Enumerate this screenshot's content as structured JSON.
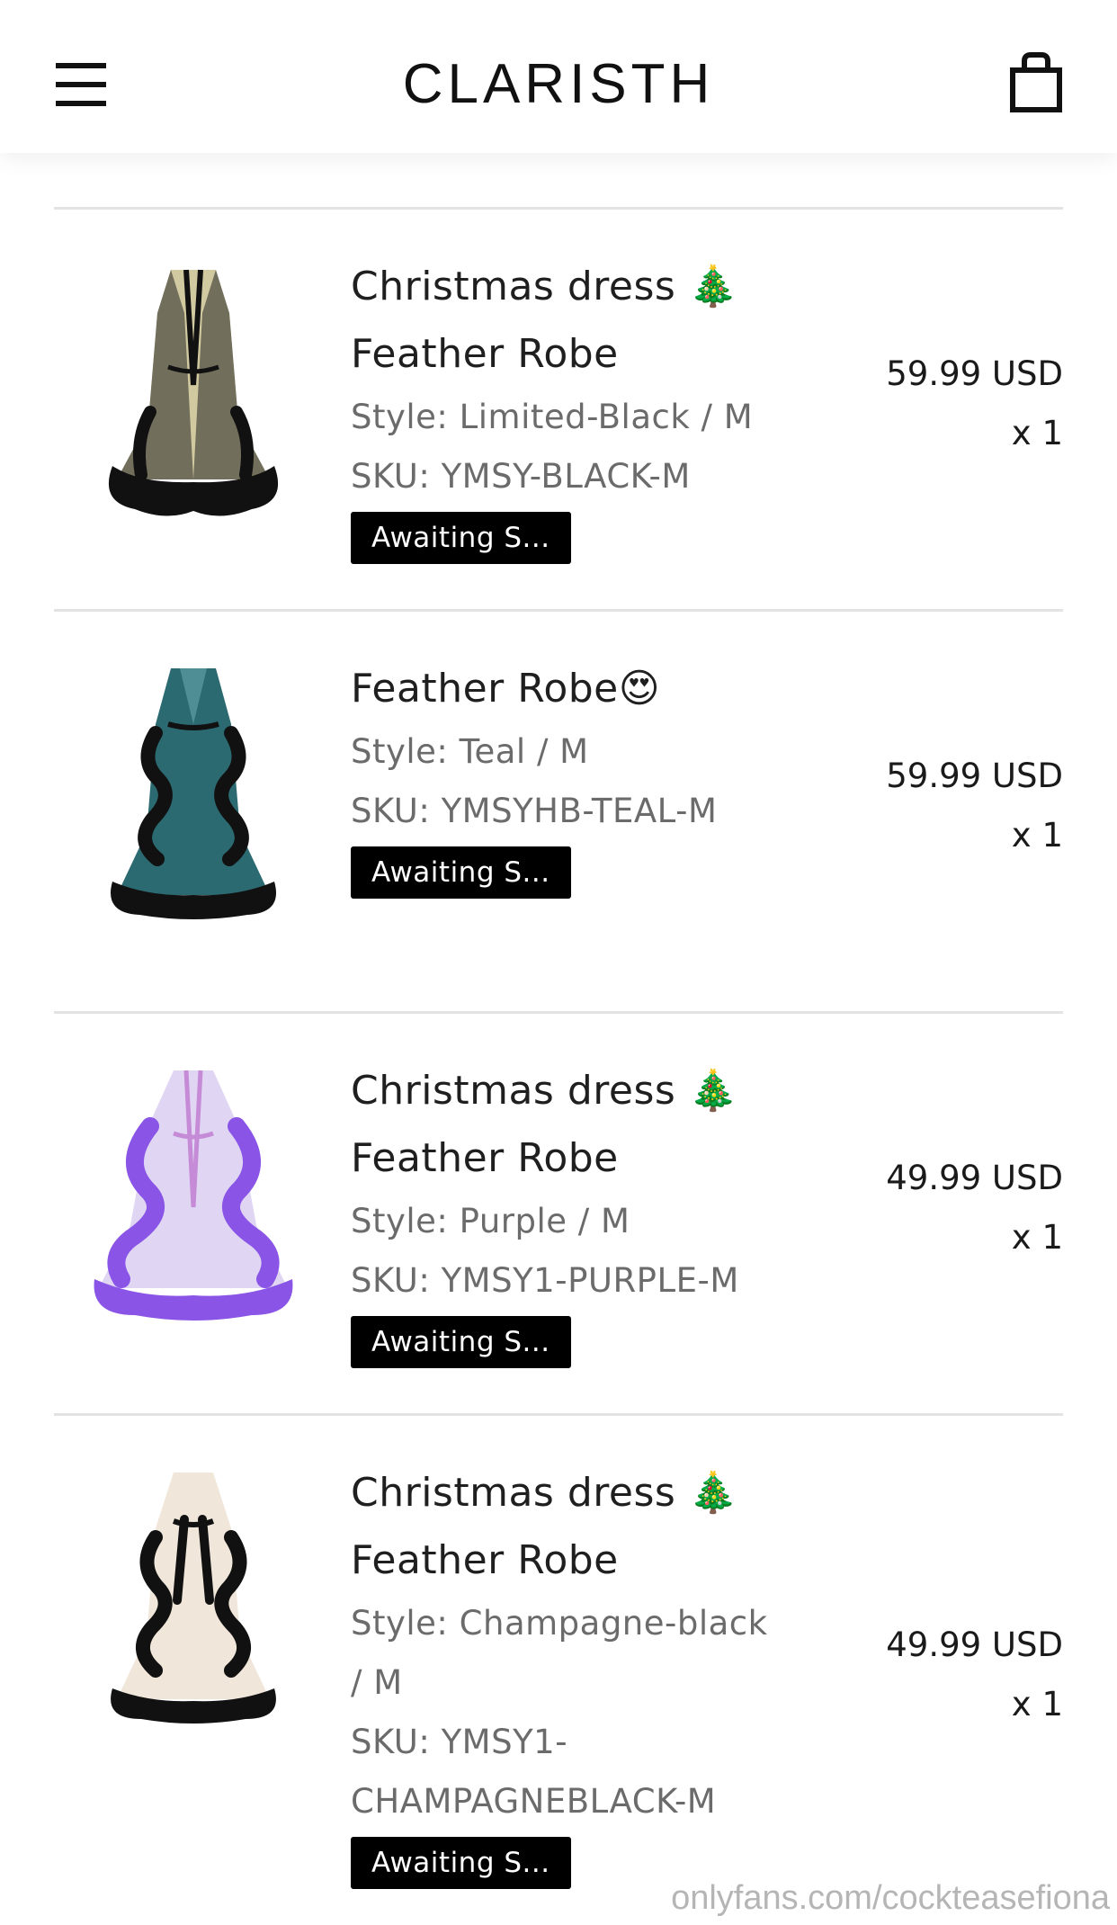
{
  "header": {
    "brand": "CLARISTH",
    "menu_icon": "hamburger-menu-icon",
    "cart_icon": "shopping-bag-icon"
  },
  "items": [
    {
      "title_line1": "Christmas dress",
      "title_emoji": "🎄",
      "title_line2": "Feather Robe",
      "style": "Style: Limited-Black / M",
      "sku": "SKU: YMSY-BLACK-M",
      "status": "Awaiting S...",
      "price": "59.99 USD",
      "qty": "x 1",
      "color_main": "#111111",
      "color_inner": "#c9bf8e"
    },
    {
      "title_line1": "Feather Robe",
      "title_emoji": "😍",
      "style": "Style: Teal / M",
      "sku": "SKU: YMSYHB-TEAL-M",
      "status": "Awaiting S...",
      "price": "59.99 USD",
      "qty": "x 1",
      "color_main": "#2c6a72",
      "color_inner": "#4f8e95"
    },
    {
      "title_line1": "Christmas dress",
      "title_emoji": "🎄",
      "title_line2": "Feather Robe",
      "style": "Style: Purple / M",
      "sku": "SKU: YMSY1-PURPLE-M",
      "status": "Awaiting S...",
      "price": "49.99 USD",
      "qty": "x 1",
      "color_main": "#8a55e6",
      "color_inner": "#ddd2f3"
    },
    {
      "title_line1": "Christmas dress",
      "title_emoji": "🎄",
      "title_line2": "Feather Robe",
      "style_line1": "Style: Champagne-black",
      "style_line2": "/ M",
      "sku_line1": "SKU: YMSY1-",
      "sku_line2": "CHAMPAGNEBLACK-M",
      "status": "Awaiting S...",
      "price": "49.99 USD",
      "qty": "x 1",
      "color_main": "#111111",
      "color_inner": "#f0e6d9"
    }
  ],
  "watermark": "onlyfans.com/cockteasefiona"
}
